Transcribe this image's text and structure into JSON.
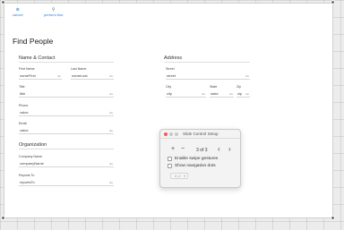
{
  "toolbar": {
    "cancel_label": "cancel",
    "perform_label": "perform find",
    "cancel_icon": "close-circle-icon",
    "perform_icon": "magnifier-icon"
  },
  "page": {
    "title": "Find People"
  },
  "name_contact": {
    "section_title": "Name & Contact",
    "first_name": {
      "label": "First Name",
      "value": "nameFirst"
    },
    "last_name": {
      "label": "Last Name",
      "value": "nameLast"
    },
    "title": {
      "label": "Title",
      "value": "title"
    },
    "phone": {
      "label": "Phone",
      "value": "value"
    },
    "email": {
      "label": "Email",
      "value": "value"
    }
  },
  "organization": {
    "section_title": "Organization",
    "company_name": {
      "label": "Company Name",
      "value": "companyName"
    },
    "reports_to": {
      "label": "Reports To",
      "value": "reportsTo"
    }
  },
  "address": {
    "section_title": "Address",
    "street": {
      "label": "Street",
      "value": "street"
    },
    "city": {
      "label": "City",
      "value": "city"
    },
    "state": {
      "label": "State",
      "value": "state"
    },
    "zip": {
      "label": "Zip",
      "value": "zip"
    }
  },
  "field_clear_glyph": "Ex",
  "slide_control": {
    "title": "Slide Control Setup",
    "add_label": "+",
    "remove_label": "−",
    "page_counter": "3 of 3",
    "prev_label": "‹",
    "next_label": "›",
    "enable_swipe_label": "Enable swipe gestures",
    "enable_swipe_checked": false,
    "show_dots_label": "Show navigation dots",
    "show_dots_checked": false,
    "dots_select_value": "8 pt"
  },
  "colors": {
    "accent_blue": "#2a7fd9",
    "traffic_red": "#ee5f57",
    "traffic_gray": "#c8c8c8"
  }
}
